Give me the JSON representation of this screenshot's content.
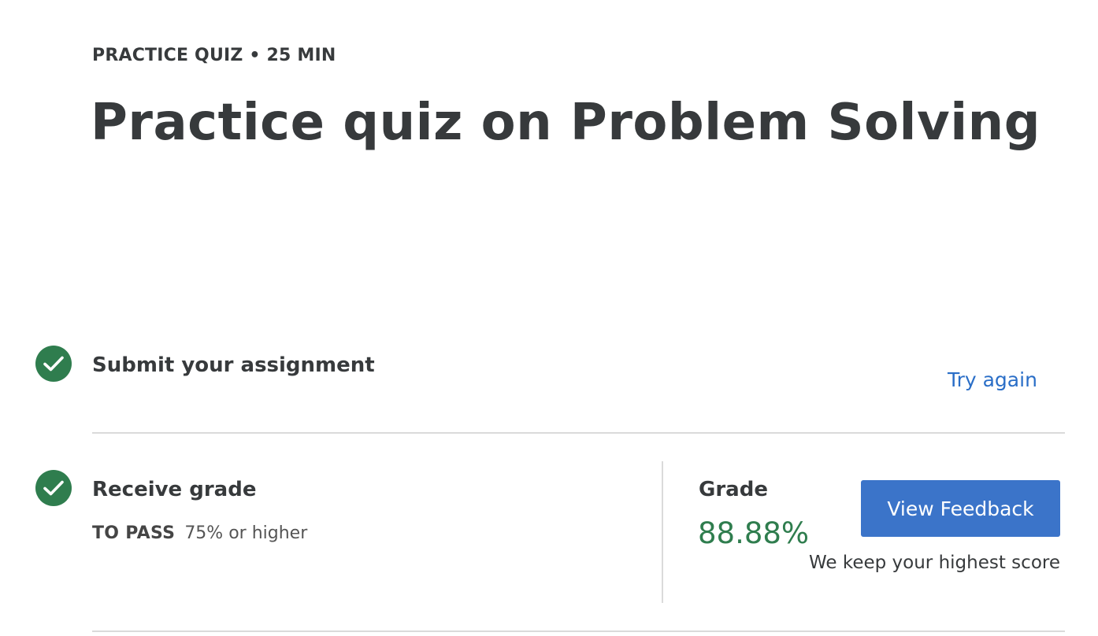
{
  "header": {
    "kicker": "PRACTICE QUIZ • 25 MIN",
    "title": "Practice quiz on Problem Solving"
  },
  "steps": [
    {
      "title": "Submit your assignment",
      "status_icon": "check-circle-icon",
      "action_label": "Try again"
    },
    {
      "title": "Receive grade",
      "status_icon": "check-circle-icon",
      "pass_label": "TO PASS",
      "pass_value": "75% or higher"
    }
  ],
  "grade": {
    "label": "Grade",
    "value": "88.88%",
    "button_label": "View Feedback",
    "note": "We keep your highest score"
  },
  "colors": {
    "success": "#2f7d4e",
    "link": "#2a6ec7",
    "button": "#3b74c9",
    "text": "#373a3c",
    "divider": "#dadada"
  }
}
